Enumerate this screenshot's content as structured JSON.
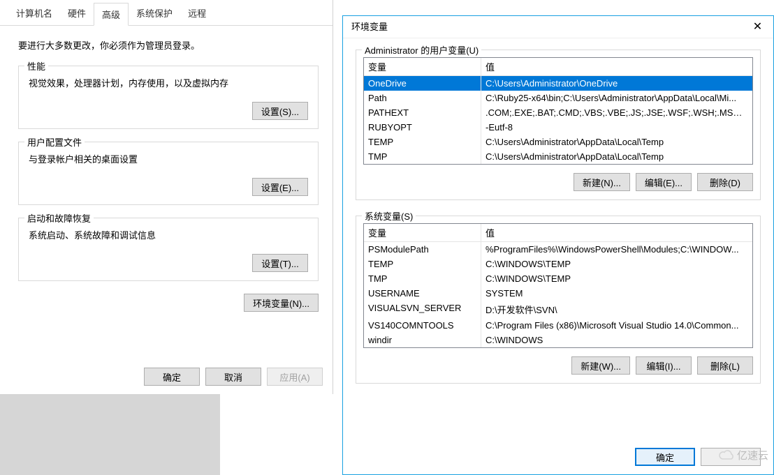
{
  "left": {
    "tabs": [
      "计算机名",
      "硬件",
      "高级",
      "系统保护",
      "远程"
    ],
    "active_tab_index": 2,
    "intro": "要进行大多数更改，你必须作为管理员登录。",
    "group1": {
      "legend": "性能",
      "desc": "视觉效果，处理器计划，内存使用，以及虚拟内存",
      "btn": "设置(S)..."
    },
    "group2": {
      "legend": "用户配置文件",
      "desc": "与登录帐户相关的桌面设置",
      "btn": "设置(E)..."
    },
    "group3": {
      "legend": "启动和故障恢复",
      "desc": "系统启动、系统故障和调试信息",
      "btn": "设置(T)..."
    },
    "env_btn": "环境变量(N)...",
    "ok": "确定",
    "cancel": "取消",
    "apply": "应用(A)"
  },
  "env": {
    "title": "环境变量",
    "user_legend": "Administrator 的用户变量(U)",
    "sys_legend": "系统变量(S)",
    "col_var": "变量",
    "col_val": "值",
    "user_vars": [
      {
        "name": "OneDrive",
        "value": "C:\\Users\\Administrator\\OneDrive",
        "selected": true
      },
      {
        "name": "Path",
        "value": "C:\\Ruby25-x64\\bin;C:\\Users\\Administrator\\AppData\\Local\\Mi..."
      },
      {
        "name": "PATHEXT",
        "value": ".COM;.EXE;.BAT;.CMD;.VBS;.VBE;.JS;.JSE;.WSF;.WSH;.MSC;.RB;...."
      },
      {
        "name": "RUBYOPT",
        "value": "-Eutf-8"
      },
      {
        "name": "TEMP",
        "value": "C:\\Users\\Administrator\\AppData\\Local\\Temp"
      },
      {
        "name": "TMP",
        "value": "C:\\Users\\Administrator\\AppData\\Local\\Temp"
      }
    ],
    "sys_vars": [
      {
        "name": "PSModulePath",
        "value": "%ProgramFiles%\\WindowsPowerShell\\Modules;C:\\WINDOW..."
      },
      {
        "name": "TEMP",
        "value": "C:\\WINDOWS\\TEMP"
      },
      {
        "name": "TMP",
        "value": "C:\\WINDOWS\\TEMP"
      },
      {
        "name": "USERNAME",
        "value": "SYSTEM"
      },
      {
        "name": "VISUALSVN_SERVER",
        "value": "D:\\开发软件\\SVN\\"
      },
      {
        "name": "VS140COMNTOOLS",
        "value": "C:\\Program Files (x86)\\Microsoft Visual Studio 14.0\\Common..."
      },
      {
        "name": "windir",
        "value": "C:\\WINDOWS"
      }
    ],
    "new_u": "新建(N)...",
    "edit_u": "编辑(E)...",
    "del_u": "删除(D)",
    "new_s": "新建(W)...",
    "edit_s": "编辑(I)...",
    "del_s": "删除(L)",
    "ok": "确定"
  },
  "watermark": "亿速云"
}
